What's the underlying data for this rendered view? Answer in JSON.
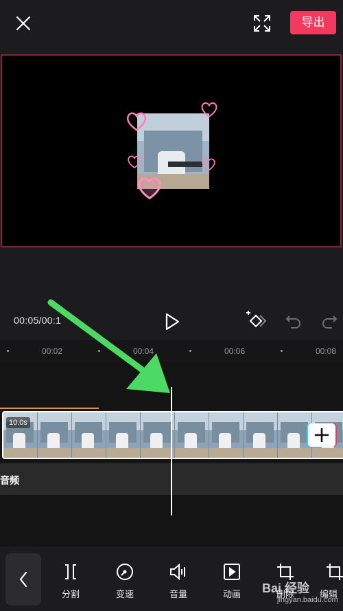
{
  "topbar": {
    "export_label": "导出"
  },
  "playback": {
    "timecode": "00:05/00:1"
  },
  "ruler": {
    "ticks": [
      "00:02",
      "00:04",
      "00:06",
      "00:08"
    ]
  },
  "track": {
    "duration_badge": "10.0s"
  },
  "audio": {
    "label": "音频"
  },
  "toolbar": {
    "items": [
      {
        "label": "分割",
        "icon": "split-icon"
      },
      {
        "label": "变速",
        "icon": "speed-icon"
      },
      {
        "label": "音量",
        "icon": "volume-icon"
      },
      {
        "label": "动画",
        "icon": "animation-icon"
      },
      {
        "label": "删除",
        "icon": "crop-icon"
      },
      {
        "label": "编辑",
        "icon": "edit-icon"
      }
    ]
  },
  "watermark": {
    "text": "Bai 经验",
    "sub": "jingyan.baidu.com"
  },
  "colors": {
    "accent": "#f5385d",
    "timeline_progress": "#f08a3a",
    "annotation_arrow": "#4cd964"
  }
}
